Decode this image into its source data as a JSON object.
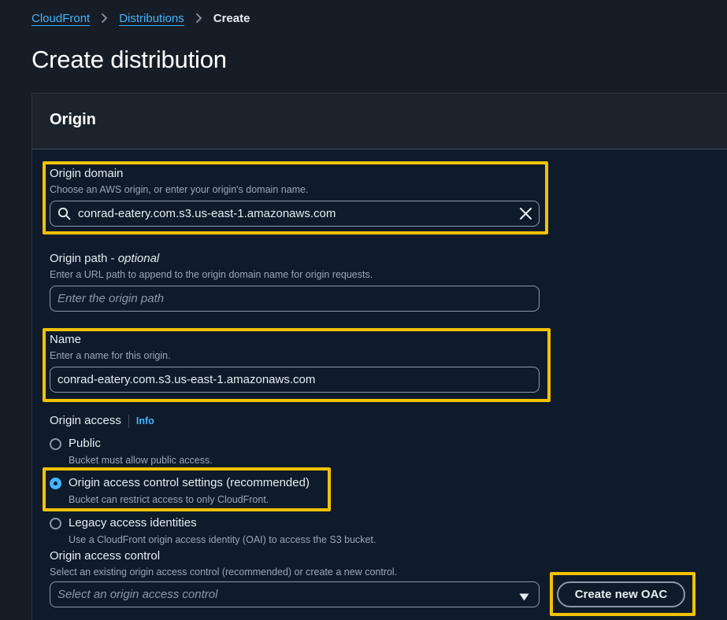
{
  "breadcrumb": {
    "items": [
      {
        "label": "CloudFront"
      },
      {
        "label": "Distributions"
      }
    ],
    "current": "Create"
  },
  "page": {
    "title": "Create distribution"
  },
  "origin_panel": {
    "title": "Origin",
    "origin_domain": {
      "label": "Origin domain",
      "hint": "Choose an AWS origin, or enter your origin's domain name.",
      "value": "conrad-eatery.com.s3.us-east-1.amazonaws.com",
      "icon": "search-icon",
      "clear_icon": "close-icon"
    },
    "origin_path": {
      "label": "Origin path",
      "optional_label": "optional",
      "hint": "Enter a URL path to append to the origin domain name for origin requests.",
      "placeholder": "Enter the origin path"
    },
    "name": {
      "label": "Name",
      "hint": "Enter a name for this origin.",
      "value": "conrad-eatery.com.s3.us-east-1.amazonaws.com"
    },
    "origin_access": {
      "label": "Origin access",
      "info_label": "Info",
      "options": [
        {
          "label": "Public",
          "description": "Bucket must allow public access.",
          "selected": false
        },
        {
          "label": "Origin access control settings (recommended)",
          "description": "Bucket can restrict access to only CloudFront.",
          "selected": true
        },
        {
          "label": "Legacy access identities",
          "description": "Use a CloudFront origin access identity (OAI) to access the S3 bucket.",
          "selected": false
        }
      ]
    },
    "origin_access_control": {
      "label": "Origin access control",
      "hint": "Select an existing origin access control (recommended) or create a new control.",
      "placeholder": "Select an origin access control",
      "create_button_label": "Create new OAC"
    }
  },
  "colors": {
    "background": "#161d26",
    "link": "#42b4ff",
    "highlight": "#f2c200"
  }
}
